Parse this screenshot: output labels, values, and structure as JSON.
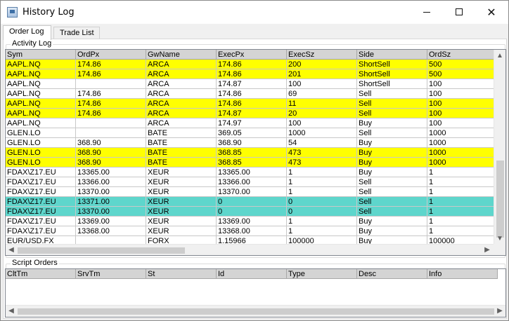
{
  "window": {
    "title": "History Log",
    "icon": "app-window-icon",
    "controls": [
      "minimize",
      "maximize",
      "close"
    ]
  },
  "tabs": [
    {
      "label": "Order Log",
      "active": true
    },
    {
      "label": "Trade List",
      "active": false
    }
  ],
  "activity_log": {
    "label": "Activity Log",
    "columns": [
      "Sym",
      "OrdPx",
      "GwName",
      "ExecPx",
      "ExecSz",
      "Side",
      "OrdSz"
    ],
    "rows": [
      {
        "highlight": "yellow",
        "cells": [
          "AAPL.NQ",
          "174.86",
          "ARCA",
          "174.86",
          "200",
          "ShortSell",
          "500"
        ]
      },
      {
        "highlight": "yellow",
        "cells": [
          "AAPL.NQ",
          "174.86",
          "ARCA",
          "174.86",
          "201",
          "ShortSell",
          "500"
        ]
      },
      {
        "highlight": "white",
        "cells": [
          "AAPL.NQ",
          "",
          "ARCA",
          "174.87",
          "100",
          "ShortSell",
          "100"
        ]
      },
      {
        "highlight": "white",
        "cells": [
          "AAPL.NQ",
          "174.86",
          "ARCA",
          "174.86",
          "69",
          "Sell",
          "100"
        ]
      },
      {
        "highlight": "yellow",
        "cells": [
          "AAPL.NQ",
          "174.86",
          "ARCA",
          "174.86",
          "11",
          "Sell",
          "100"
        ]
      },
      {
        "highlight": "yellow",
        "cells": [
          "AAPL.NQ",
          "174.86",
          "ARCA",
          "174.87",
          "20",
          "Sell",
          "100"
        ]
      },
      {
        "highlight": "white",
        "cells": [
          "AAPL.NQ",
          "",
          "ARCA",
          "174.97",
          "100",
          "Buy",
          "100"
        ]
      },
      {
        "highlight": "white",
        "cells": [
          "GLEN.LO",
          "",
          "BATE",
          "369.05",
          "1000",
          "Sell",
          "1000"
        ]
      },
      {
        "highlight": "white",
        "cells": [
          "GLEN.LO",
          "368.90",
          "BATE",
          "368.90",
          "54",
          "Buy",
          "1000"
        ]
      },
      {
        "highlight": "yellow",
        "cells": [
          "GLEN.LO",
          "368.90",
          "BATE",
          "368.85",
          "473",
          "Buy",
          "1000"
        ]
      },
      {
        "highlight": "yellow",
        "cells": [
          "GLEN.LO",
          "368.90",
          "BATE",
          "368.85",
          "473",
          "Buy",
          "1000"
        ]
      },
      {
        "highlight": "white",
        "cells": [
          "FDAX\\Z17.EU",
          "13365.00",
          "XEUR",
          "13365.00",
          "1",
          "Buy",
          "1"
        ]
      },
      {
        "highlight": "white",
        "cells": [
          "FDAX\\Z17.EU",
          "13366.00",
          "XEUR",
          "13366.00",
          "1",
          "Sell",
          "1"
        ]
      },
      {
        "highlight": "white",
        "cells": [
          "FDAX\\Z17.EU",
          "13370.00",
          "XEUR",
          "13370.00",
          "1",
          "Sell",
          "1"
        ]
      },
      {
        "highlight": "teal",
        "cells": [
          "FDAX\\Z17.EU",
          "13371.00",
          "XEUR",
          "0",
          "0",
          "Sell",
          "1"
        ]
      },
      {
        "highlight": "teal",
        "cells": [
          "FDAX\\Z17.EU",
          "13370.00",
          "XEUR",
          "0",
          "0",
          "Sell",
          "1"
        ]
      },
      {
        "highlight": "white",
        "cells": [
          "FDAX\\Z17.EU",
          "13369.00",
          "XEUR",
          "13369.00",
          "1",
          "Buy",
          "1"
        ]
      },
      {
        "highlight": "white",
        "cells": [
          "FDAX\\Z17.EU",
          "13368.00",
          "XEUR",
          "13368.00",
          "1",
          "Buy",
          "1"
        ]
      },
      {
        "highlight": "white",
        "cells": [
          "EUR/USD.FX",
          "",
          "FORX",
          "1.15966",
          "100000",
          "Buy",
          "100000"
        ]
      }
    ]
  },
  "script_orders": {
    "label": "Script Orders",
    "columns": [
      "CltTm",
      "SrvTm",
      "St",
      "Id",
      "Type",
      "Desc",
      "Info"
    ],
    "rows": []
  },
  "colors": {
    "yellow": "#ffff00",
    "teal": "#5ed6cc",
    "header": "#d4d4d4"
  }
}
